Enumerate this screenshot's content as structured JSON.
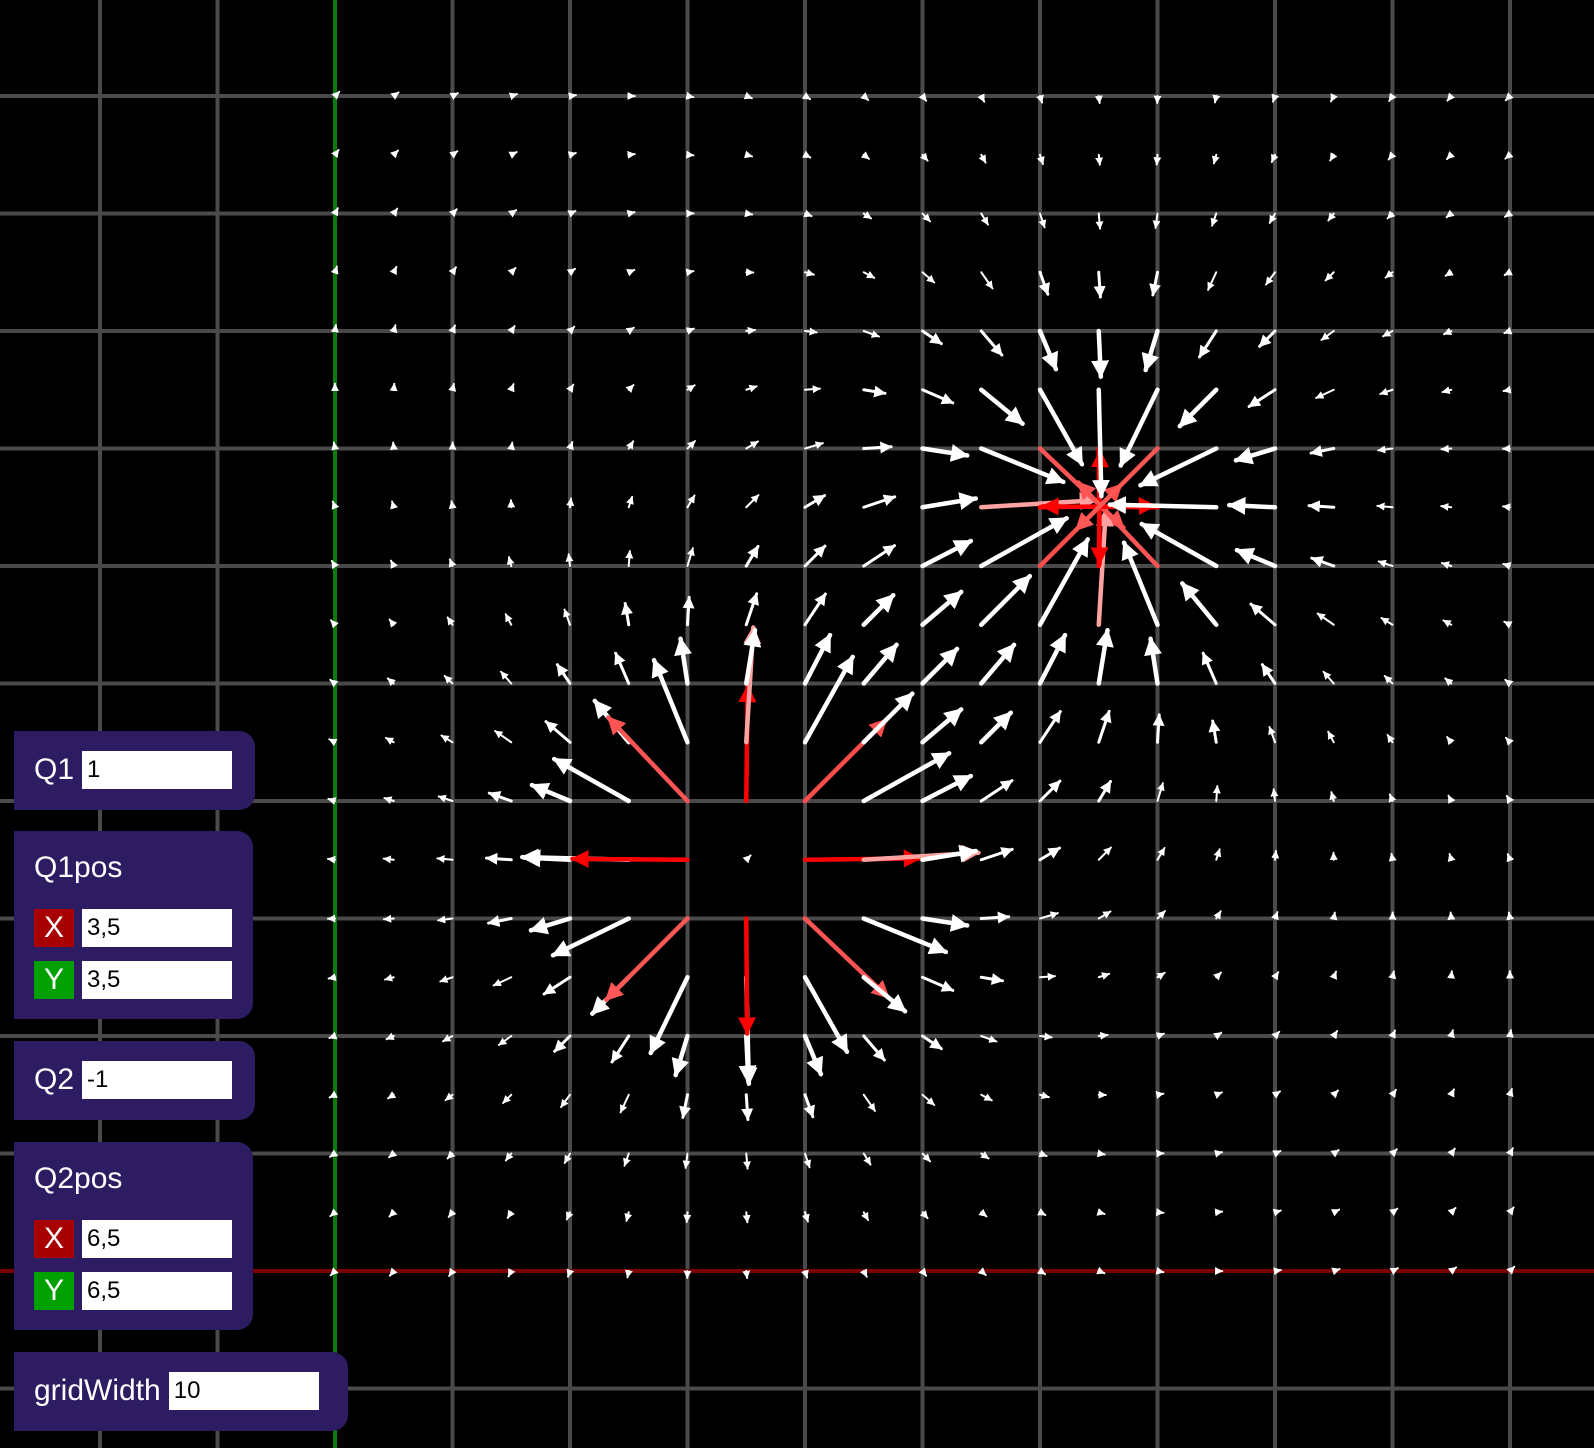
{
  "colors": {
    "background": "#000000",
    "grid_line": "#4a4a4a",
    "y_axis": "#0a7a0a",
    "x_axis": "#7a0000",
    "panel": "#2e1c63",
    "x_badge": "#a80000",
    "y_badge": "#00a000",
    "arrow_weak": "#ffffff",
    "arrow_strong": "#ff0000"
  },
  "world": {
    "x_range": [
      0,
      10
    ],
    "y_range": [
      0,
      10
    ],
    "grid_spacing": 1,
    "vector_spacing": 0.5
  },
  "controls": {
    "q1": {
      "label": "Q1",
      "value": "1"
    },
    "q1pos": {
      "label": "Q1pos",
      "x_label": "X",
      "x_value": "3,5",
      "y_label": "Y",
      "y_value": "3,5"
    },
    "q2": {
      "label": "Q2",
      "value": "-1"
    },
    "q2pos": {
      "label": "Q2pos",
      "x_label": "X",
      "x_value": "6,5",
      "y_label": "Y",
      "y_value": "6,5"
    },
    "grid_width": {
      "label": "gridWidth",
      "value": "10"
    }
  }
}
